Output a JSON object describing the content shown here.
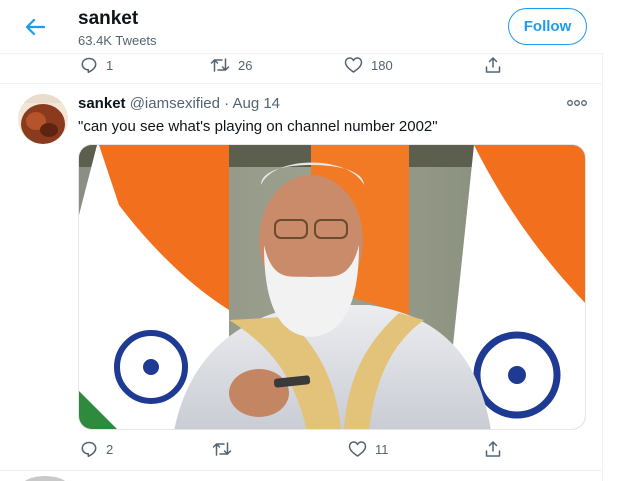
{
  "header": {
    "name": "sanket",
    "tweet_count": "63.4K Tweets",
    "follow_label": "Follow",
    "back_icon": "arrow-left-icon"
  },
  "previous_tweet": {
    "replies": "1",
    "retweets": "26",
    "likes": "180"
  },
  "tweet": {
    "name": "sanket",
    "handle": "@iamsexified",
    "dot": "·",
    "date": "Aug 14",
    "text": "\"can you see what's playing on channel number 2002\"",
    "replies": "2",
    "retweets": "",
    "likes": "11"
  },
  "colors": {
    "accent": "#1d9bf0",
    "secondary_text": "#536471",
    "divider": "#eff3f4"
  }
}
